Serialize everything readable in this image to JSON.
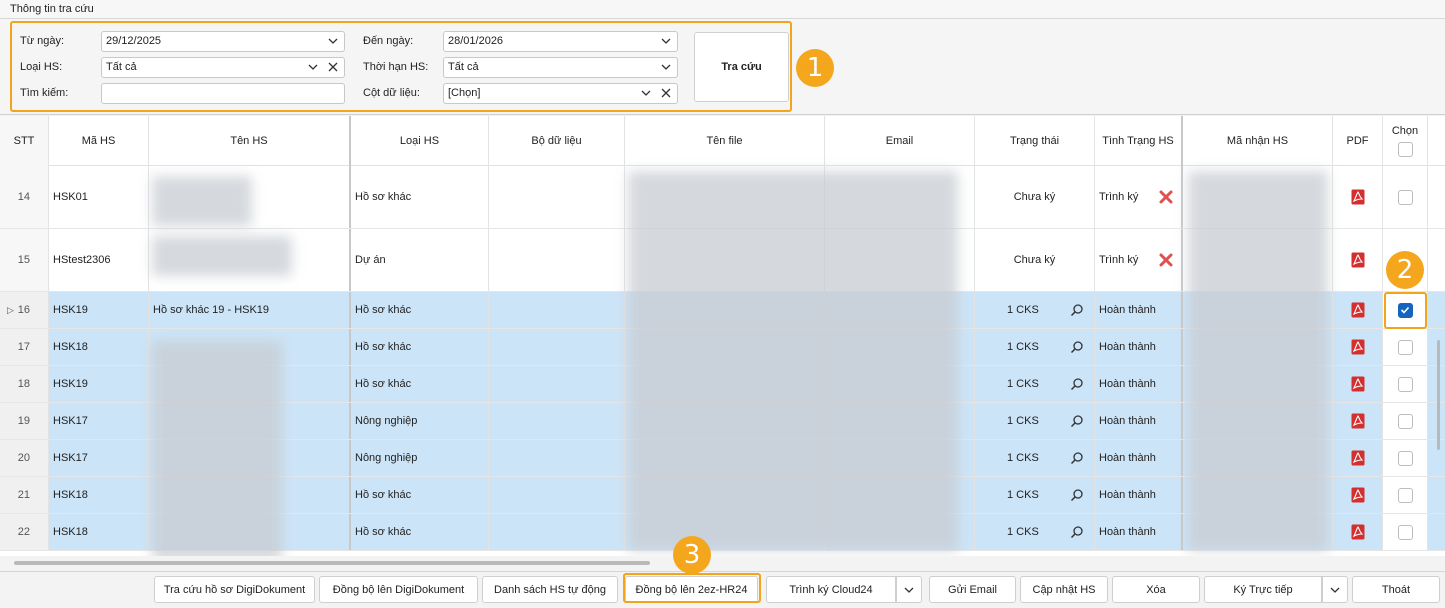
{
  "section_title": "Thông tin tra cứu",
  "form": {
    "from_date_label": "Từ ngày:",
    "from_date_value": "29/12/2025",
    "to_date_label": "Đến ngày:",
    "to_date_value": "28/01/2026",
    "record_type_label": "Loại HS:",
    "record_type_value": "Tất cả",
    "record_term_label": "Thời hạn HS:",
    "record_term_value": "Tất cả",
    "search_label": "Tìm kiếm:",
    "search_value": "",
    "data_column_label": "Cột dữ liệu:",
    "data_column_value": "[Chọn]",
    "search_button": "Tra cứu"
  },
  "annotations": {
    "badge1": "1",
    "badge2": "2",
    "badge3": "3",
    "accent": "#f4a61c"
  },
  "grid": {
    "headers": {
      "stt": "STT",
      "code": "Mã HS",
      "name": "Tên HS",
      "type": "Loại HS",
      "dataset": "Bộ dữ liệu",
      "file": "Tên file",
      "email": "Email",
      "status": "Trạng thái",
      "state": "Tình Trạng HS",
      "receiver": "Mã nhận HS",
      "pdf": "PDF",
      "select": "Chọn"
    },
    "rows": [
      {
        "stt": "14",
        "code": "HSK01",
        "name": "",
        "type": "Hồ sơ khác",
        "status": "Chưa ký",
        "state": "Trình ký"
      },
      {
        "stt": "15",
        "code": "HStest2306",
        "name": "",
        "type": "Dự án",
        "status": "Chưa ký",
        "state": "Trình ký"
      },
      {
        "stt": "16",
        "code": "HSK19",
        "name": "Hồ sơ khác 19 - HSK19",
        "type": "Hồ sơ khác",
        "status": "1 CKS",
        "state": "Hoàn thành"
      },
      {
        "stt": "17",
        "code": "HSK18",
        "name": "",
        "type": "Hồ sơ khác",
        "status": "1 CKS",
        "state": "Hoàn thành"
      },
      {
        "stt": "18",
        "code": "HSK19",
        "name": "",
        "type": "Hồ sơ khác",
        "status": "1 CKS",
        "state": "Hoàn thành"
      },
      {
        "stt": "19",
        "code": "HSK17",
        "name": "",
        "type": "Nông nghiệp",
        "status": "1 CKS",
        "state": "Hoàn thành"
      },
      {
        "stt": "20",
        "code": "HSK17",
        "name": "",
        "type": "Nông nghiệp",
        "status": "1 CKS",
        "state": "Hoàn thành"
      },
      {
        "stt": "21",
        "code": "HSK18",
        "name": "",
        "type": "Hồ sơ khác",
        "status": "1 CKS",
        "state": "Hoàn thành"
      },
      {
        "stt": "22",
        "code": "HSK18",
        "name": "",
        "type": "Hồ sơ khác",
        "status": "1 CKS",
        "state": "Hoàn thành"
      }
    ]
  },
  "footer": {
    "btn_lookup_digi": "Tra cứu hồ sơ DigiDokument",
    "btn_sync_digi": "Đồng bộ lên DigiDokument",
    "btn_auto_list": "Danh sách HS tự động",
    "btn_sync_hr24": "Đồng bộ lên 2ez-HR24",
    "btn_cloud24": "Trình ký Cloud24",
    "btn_email": "Gửi Email",
    "btn_update": "Cập nhật HS",
    "btn_delete": "Xóa",
    "btn_sign_direct": "Ký Trực tiếp",
    "btn_exit": "Thoát"
  },
  "icons": [
    "chevron-down-icon",
    "close-icon",
    "pdf-icon",
    "magnifier-icon",
    "red-x-icon",
    "checkbox-icon",
    "row-pointer-icon"
  ]
}
